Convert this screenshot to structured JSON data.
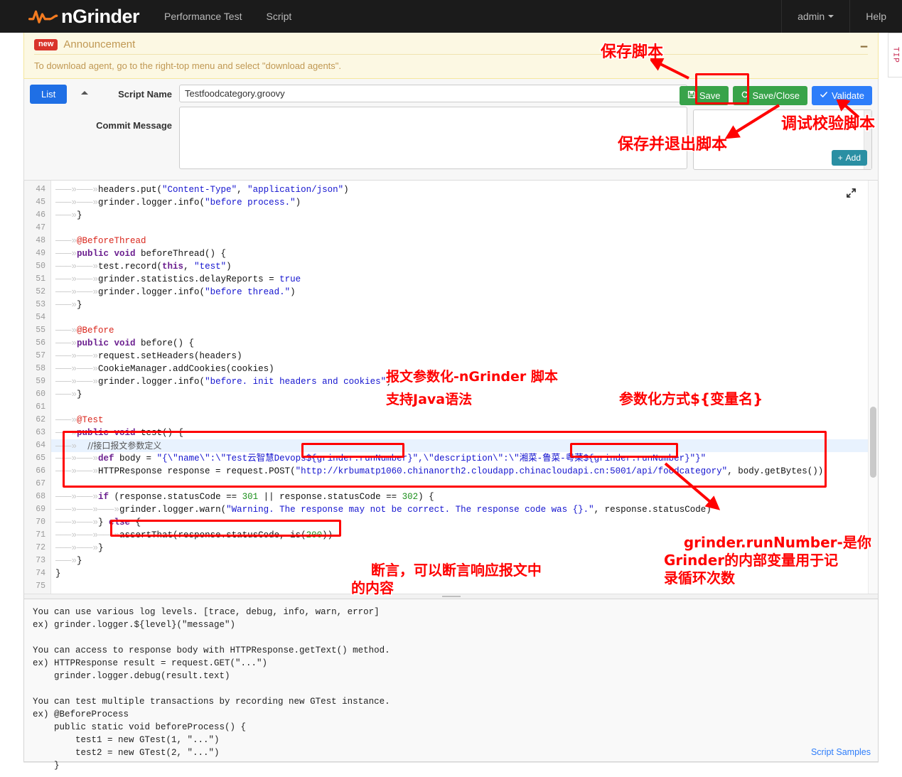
{
  "navbar": {
    "brand": "nGrinder",
    "links": [
      {
        "label": "Performance Test",
        "name": "nav-performance-test"
      },
      {
        "label": "Script",
        "name": "nav-script"
      }
    ],
    "user": "admin",
    "help": "Help"
  },
  "announcement": {
    "badge": "new",
    "title": "Announcement",
    "body": "To download agent, go to the right-top menu and select \"download agents\".",
    "collapse_glyph": "−",
    "tip_tab": "TIP"
  },
  "form": {
    "list_button": "List",
    "script_name_label": "Script Name",
    "script_name_value": "Testfoodcategory.groovy",
    "commit_label": "Commit Message",
    "commit_value": "",
    "commit_placeholder": "",
    "save_label": "Save",
    "save_close_label": "Save/Close",
    "validate_label": "Validate",
    "add_label": "Add"
  },
  "editor": {
    "first_line_number": 44,
    "lines": [
      {
        "n": 44,
        "indent": 2,
        "tokens": [
          {
            "t": "pln",
            "v": "headers.put("
          },
          {
            "t": "str",
            "v": "\"Content-Type\""
          },
          {
            "t": "pln",
            "v": ", "
          },
          {
            "t": "str",
            "v": "\"application/json\""
          },
          {
            "t": "pln",
            "v": ")"
          }
        ]
      },
      {
        "n": 45,
        "indent": 2,
        "tokens": [
          {
            "t": "pln",
            "v": "grinder.logger.info("
          },
          {
            "t": "str",
            "v": "\"before process.\""
          },
          {
            "t": "pln",
            "v": ")"
          }
        ]
      },
      {
        "n": 46,
        "indent": 1,
        "tokens": [
          {
            "t": "pln",
            "v": "}"
          }
        ]
      },
      {
        "n": 47,
        "indent": 0,
        "tokens": []
      },
      {
        "n": 48,
        "indent": 1,
        "tokens": [
          {
            "t": "ann",
            "v": "@BeforeThread"
          }
        ]
      },
      {
        "n": 49,
        "indent": 1,
        "tokens": [
          {
            "t": "kw",
            "v": "public void "
          },
          {
            "t": "pln",
            "v": "beforeThread() {"
          }
        ]
      },
      {
        "n": 50,
        "indent": 2,
        "tokens": [
          {
            "t": "pln",
            "v": "test.record("
          },
          {
            "t": "kw",
            "v": "this"
          },
          {
            "t": "pln",
            "v": ", "
          },
          {
            "t": "str",
            "v": "\"test\""
          },
          {
            "t": "pln",
            "v": ")"
          }
        ]
      },
      {
        "n": 51,
        "indent": 2,
        "tokens": [
          {
            "t": "pln",
            "v": "grinder.statistics.delayReports = "
          },
          {
            "t": "str",
            "v": "true"
          }
        ]
      },
      {
        "n": 52,
        "indent": 2,
        "tokens": [
          {
            "t": "pln",
            "v": "grinder.logger.info("
          },
          {
            "t": "str",
            "v": "\"before thread.\""
          },
          {
            "t": "pln",
            "v": ")"
          }
        ]
      },
      {
        "n": 53,
        "indent": 1,
        "tokens": [
          {
            "t": "pln",
            "v": "}"
          }
        ]
      },
      {
        "n": 54,
        "indent": 0,
        "tokens": []
      },
      {
        "n": 55,
        "indent": 1,
        "tokens": [
          {
            "t": "ann",
            "v": "@Before"
          }
        ]
      },
      {
        "n": 56,
        "indent": 1,
        "tokens": [
          {
            "t": "kw",
            "v": "public void "
          },
          {
            "t": "pln",
            "v": "before() {"
          }
        ]
      },
      {
        "n": 57,
        "indent": 2,
        "tokens": [
          {
            "t": "pln",
            "v": "request.setHeaders(headers)"
          }
        ]
      },
      {
        "n": 58,
        "indent": 2,
        "tokens": [
          {
            "t": "pln",
            "v": "CookieManager.addCookies(cookies)"
          }
        ]
      },
      {
        "n": 59,
        "indent": 2,
        "tokens": [
          {
            "t": "pln",
            "v": "grinder.logger.info("
          },
          {
            "t": "str",
            "v": "\"before. init headers and cookies\""
          },
          {
            "t": "pln",
            "v": ")"
          }
        ]
      },
      {
        "n": 60,
        "indent": 1,
        "tokens": [
          {
            "t": "pln",
            "v": "}"
          }
        ]
      },
      {
        "n": 61,
        "indent": 0,
        "tokens": []
      },
      {
        "n": 62,
        "indent": 1,
        "tokens": [
          {
            "t": "ann",
            "v": "@Test"
          }
        ]
      },
      {
        "n": 63,
        "indent": 1,
        "tokens": [
          {
            "t": "kw",
            "v": "public void "
          },
          {
            "t": "pln",
            "v": "test() {"
          }
        ]
      },
      {
        "n": 64,
        "indent": 1,
        "highlight": true,
        "tokens": [
          {
            "t": "cmt",
            "v": "    //接口报文参数定义"
          }
        ]
      },
      {
        "n": 65,
        "indent": 2,
        "tokens": [
          {
            "t": "kw",
            "v": "def "
          },
          {
            "t": "pln",
            "v": "body = "
          },
          {
            "t": "str",
            "v": "\"{\\\"name\\\":\\\"Test云智慧Devops${grinder.runNumber}\",\\\"description\\\":\\\"湘菜-鲁菜-粤菜${grinder.runNumber}\"}\""
          }
        ]
      },
      {
        "n": 66,
        "indent": 2,
        "tokens": [
          {
            "t": "pln",
            "v": "HTTPResponse response = request.POST("
          },
          {
            "t": "str",
            "v": "\"http://krbumatp1060.chinanorth2.cloudapp.chinacloudapi.cn:5001/api/foodcategory\""
          },
          {
            "t": "pln",
            "v": ", body.getBytes())"
          }
        ]
      },
      {
        "n": 67,
        "indent": 0,
        "tokens": []
      },
      {
        "n": 68,
        "indent": 2,
        "tokens": [
          {
            "t": "kw",
            "v": "if "
          },
          {
            "t": "pln",
            "v": "(response.statusCode == "
          },
          {
            "t": "num",
            "v": "301"
          },
          {
            "t": "pln",
            "v": " || response.statusCode == "
          },
          {
            "t": "num",
            "v": "302"
          },
          {
            "t": "pln",
            "v": ") {"
          }
        ]
      },
      {
        "n": 69,
        "indent": 3,
        "tokens": [
          {
            "t": "pln",
            "v": "grinder.logger.warn("
          },
          {
            "t": "str",
            "v": "\"Warning. The response may not be correct. The response code was {}.\""
          },
          {
            "t": "pln",
            "v": ", response.statusCode)"
          }
        ]
      },
      {
        "n": 70,
        "indent": 2,
        "tokens": [
          {
            "t": "pln",
            "v": "} "
          },
          {
            "t": "kw",
            "v": "else"
          },
          {
            "t": "pln",
            "v": " {"
          }
        ]
      },
      {
        "n": 71,
        "indent": 3,
        "tokens": [
          {
            "t": "pln",
            "v": "assertThat(response.statusCode, is("
          },
          {
            "t": "num",
            "v": "200"
          },
          {
            "t": "pln",
            "v": "))"
          }
        ]
      },
      {
        "n": 72,
        "indent": 2,
        "tokens": [
          {
            "t": "pln",
            "v": "}"
          }
        ]
      },
      {
        "n": 73,
        "indent": 1,
        "tokens": [
          {
            "t": "pln",
            "v": "}"
          }
        ]
      },
      {
        "n": 74,
        "indent": 0,
        "tokens": [
          {
            "t": "pln",
            "v": "}"
          }
        ]
      },
      {
        "n": 75,
        "indent": 0,
        "tokens": []
      }
    ]
  },
  "help": {
    "text": "You can use various log levels. [trace, debug, info, warn, error]\nex) grinder.logger.${level}(\"message\")\n\nYou can access to response body with HTTPResponse.getText() method.\nex) HTTPResponse result = request.GET(\"...\")\n    grinder.logger.debug(result.text)\n\nYou can test multiple transactions by recording new GTest instance.\nex) @BeforeProcess\n    public static void beforeProcess() {\n        test1 = new GTest(1, \"...\")\n        test2 = new GTest(2, \"...\")\n    }",
    "samples_link": "Script Samples"
  },
  "annotations": {
    "save_script": "保存脚本",
    "save_exit_script": "保存并退出脚本",
    "validate_script": "调试校验脚本",
    "param_line1": "报文参数化-nGrinder 脚本",
    "param_line2": "支持Java语法",
    "param_syntax": "参数化方式${变量名}",
    "runnumber_note": "grinder.runNumber-是你\nGrinder的内部变量用于记\n录循环次数",
    "assert_note": "断言，可以断言响应报文中\n的内容"
  },
  "colors": {
    "brand_orange": "#f47b20",
    "nav_bg": "#1b1b1b",
    "announce_bg": "#fcf8e3",
    "primary_blue": "#2d7dfa",
    "green": "#38a34a",
    "teal": "#2a8fa3",
    "annotation_red": "#ff0000"
  }
}
